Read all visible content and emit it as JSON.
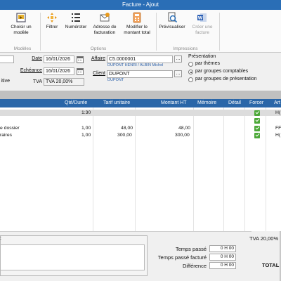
{
  "window": {
    "title": "Facture - Ajout"
  },
  "ribbon": {
    "buttons": [
      {
        "label": "Choisir un modèle",
        "icon": "choose-template-icon"
      },
      {
        "label": "Filtrer",
        "icon": "filter-icon"
      },
      {
        "label": "Numéroter",
        "icon": "numbering-icon"
      },
      {
        "label": "Adresse de facturation",
        "icon": "billing-address-icon"
      },
      {
        "label": "Modifier le montant total",
        "icon": "calculator-icon"
      },
      {
        "label": "Prévisualiser",
        "icon": "preview-icon"
      },
      {
        "label": "Créer une facture",
        "icon": "word-icon",
        "disabled": true
      }
    ],
    "groups": {
      "models": "Modèles",
      "options": "Options",
      "prints": "Impressions"
    }
  },
  "form": {
    "left_cut_label": "itive",
    "date_label": "Date",
    "date_value": "16/01/2026",
    "due_label": "Echéance",
    "due_value": "16/01/2026",
    "tva_label": "TVA",
    "tva_value": "TVA 20,00%",
    "affaire_label": "Affaire",
    "affaire_value": "C5.0000001",
    "affaire_sub": "DUPONT HENRI / ALBIN Michel",
    "client_label": "Client",
    "client_value": "DUPONT",
    "client_sub": "DUPONT",
    "presentation": {
      "title": "Présentation",
      "options": [
        "par thèmes",
        "par groupes comptables",
        "par groupes de présentation"
      ],
      "selected": 1
    }
  },
  "table": {
    "headers": [
      "Qté/Durée",
      "Tarif unitaire",
      "Montant HT",
      "Mémoire",
      "Détail",
      "Forcer",
      "Art"
    ],
    "rows": [
      {
        "label": "",
        "qty": "1:30",
        "price": "",
        "amount": "",
        "forced": true,
        "art": "H(",
        "selected": true
      },
      {
        "label": "",
        "qty": "",
        "price": "",
        "amount": "",
        "forced": true,
        "art": "",
        "selected": false
      },
      {
        "label": "e dossier",
        "qty": "1,00",
        "price": "48,00",
        "amount": "48,00",
        "forced": true,
        "art": "FF",
        "selected": false
      },
      {
        "label": "raires",
        "qty": "1,00",
        "price": "300,00",
        "amount": "300,00",
        "forced": true,
        "art": "H(",
        "selected": false
      }
    ]
  },
  "bottom": {
    "comment_label": ":",
    "time_spent_label": "Temps passé",
    "time_spent_value": "0 H 00",
    "time_billed_label": "Temps passé facturé",
    "time_billed_value": "0 H 00",
    "difference_label": "Différence",
    "difference_value": "0 H 00",
    "tva_total_label": "TVA 20,00%",
    "total_label": "TOTAL"
  }
}
